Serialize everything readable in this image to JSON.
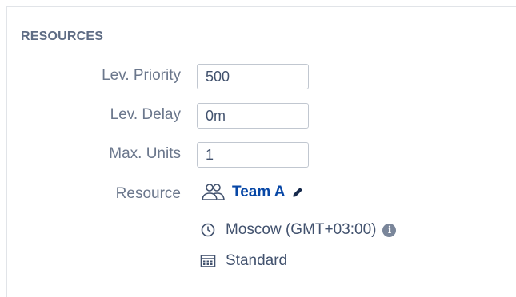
{
  "section": {
    "title": "RESOURCES"
  },
  "fields": {
    "lev_priority": {
      "label": "Lev. Priority",
      "value": "500"
    },
    "lev_delay": {
      "label": "Lev. Delay",
      "value": "0m"
    },
    "max_units": {
      "label": "Max. Units",
      "value": "1"
    }
  },
  "resource": {
    "label": "Resource",
    "team_name": "Team A",
    "timezone": "Moscow (GMT+03:00)",
    "calendar": "Standard"
  },
  "icons": {
    "team": "team-users-icon",
    "edit": "pencil-icon",
    "clock": "clock-icon",
    "info": "info-icon",
    "calendar": "calendar-icon"
  },
  "colors": {
    "link": "#0747a6",
    "label": "#6b778c",
    "text": "#42526e"
  }
}
